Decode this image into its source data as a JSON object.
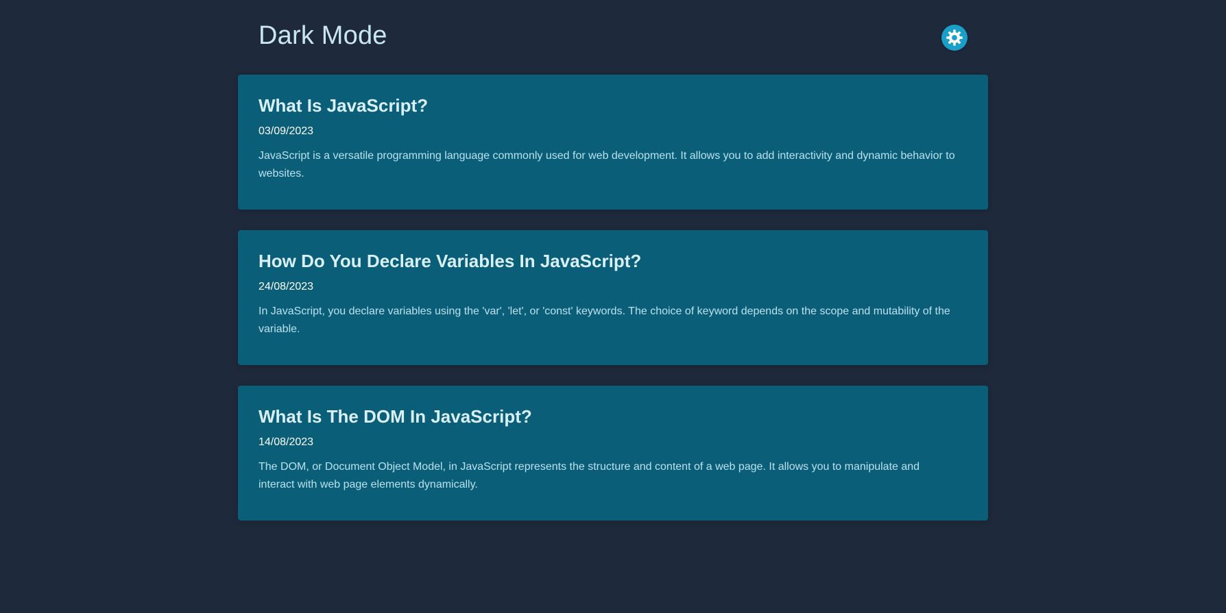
{
  "header": {
    "title": "Dark Mode",
    "toggle_icon": "gear-icon"
  },
  "colors": {
    "page_background": "#1e293b",
    "card_background": "#0b5e77",
    "title": "#c8e7f3",
    "toggle_background": "#1aa0c8"
  },
  "posts": [
    {
      "title": "What Is JavaScript?",
      "date": "03/09/2023",
      "body": "JavaScript is a versatile programming language commonly used for web development. It allows you to add interactivity and dynamic behavior to websites."
    },
    {
      "title": "How Do You Declare Variables In JavaScript?",
      "date": "24/08/2023",
      "body": "In JavaScript, you declare variables using the 'var', 'let', or 'const' keywords. The choice of keyword depends on the scope and mutability of the variable."
    },
    {
      "title": "What Is The DOM In JavaScript?",
      "date": "14/08/2023",
      "body": "The DOM, or Document Object Model, in JavaScript represents the structure and content of a web page. It allows you to manipulate and interact with web page elements dynamically."
    }
  ]
}
